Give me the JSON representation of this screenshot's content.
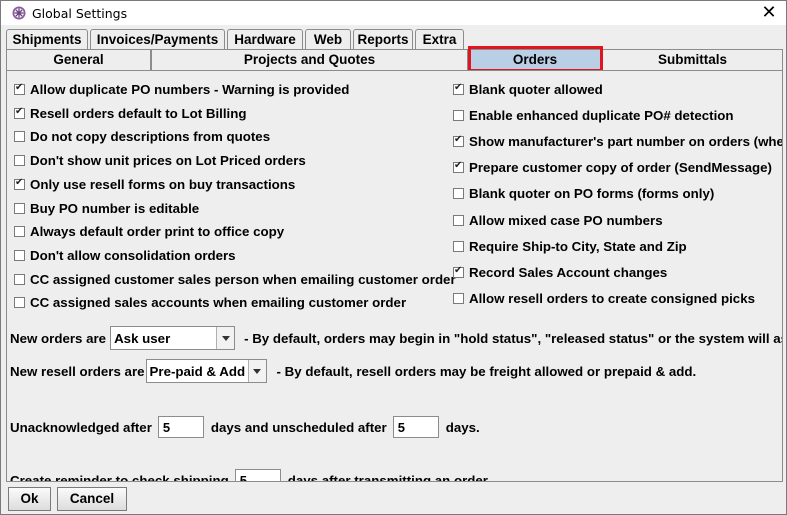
{
  "window": {
    "title": "Global Settings",
    "app_icon": "gear-flower-icon",
    "close_glyph": "✕"
  },
  "tabs_row1": [
    {
      "label": "Shipments"
    },
    {
      "label": "Invoices/Payments"
    },
    {
      "label": "Hardware"
    },
    {
      "label": "Web"
    },
    {
      "label": "Reports"
    },
    {
      "label": "Extra"
    }
  ],
  "tabs_row2": [
    {
      "label": "General"
    },
    {
      "label": "Projects and Quotes"
    },
    {
      "label": "Orders",
      "selected": true
    },
    {
      "label": "Submittals"
    }
  ],
  "colors": {
    "selected_tab": "#b8cfe5",
    "highlight_box": "#e0161c"
  },
  "left_options": [
    {
      "label": "Allow duplicate PO numbers - Warning is provided",
      "checked": true
    },
    {
      "label": "Resell orders default to Lot Billing",
      "checked": true
    },
    {
      "label": "Do not copy descriptions from quotes",
      "checked": false
    },
    {
      "label": "Don't show unit prices on Lot Priced orders",
      "checked": false
    },
    {
      "label": "Only use resell forms on buy transactions",
      "checked": true
    },
    {
      "label": "Buy PO number is editable",
      "checked": false
    },
    {
      "label": "Always default order print to office copy",
      "checked": false
    },
    {
      "label": "Don't allow consolidation orders",
      "checked": false
    },
    {
      "label": "CC assigned customer sales person when emailing customer order",
      "checked": false
    },
    {
      "label": "CC assigned sales accounts when emailing customer order",
      "checked": false
    }
  ],
  "right_options": [
    {
      "label": "Blank quoter allowed",
      "checked": true
    },
    {
      "label": "Enable enhanced duplicate PO# detection",
      "checked": false
    },
    {
      "label": "Show manufacturer's part number on orders (when",
      "checked": true
    },
    {
      "label": "Prepare customer copy of order (SendMessage)",
      "checked": true
    },
    {
      "label": "Blank quoter on PO forms (forms only)",
      "checked": false
    },
    {
      "label": "Allow mixed case PO numbers",
      "checked": false
    },
    {
      "label": "Require Ship-to City, State and Zip",
      "checked": false
    },
    {
      "label": "Record Sales Account changes",
      "checked": true
    },
    {
      "label": "Allow resell orders to create consigned picks",
      "checked": false
    }
  ],
  "new_orders": {
    "label": "New orders are",
    "value": "Ask user",
    "hint": "- By default, orders may begin in \"hold status\", \"released status\" or the system will ask"
  },
  "new_resell_orders": {
    "label": "New resell orders are",
    "value": "Pre-paid & Add",
    "hint": "- By default, resell orders may be freight allowed or prepaid & add."
  },
  "unack": {
    "label_before": "Unacknowledged after",
    "value1": "5",
    "label_middle": "days and unscheduled after",
    "value2": "5",
    "label_after": "days."
  },
  "reminder": {
    "label_before": "Create reminder to check shipping",
    "value": "5",
    "label_after": "days after transmitting an order."
  },
  "buttons": {
    "ok": "Ok",
    "cancel": "Cancel"
  }
}
